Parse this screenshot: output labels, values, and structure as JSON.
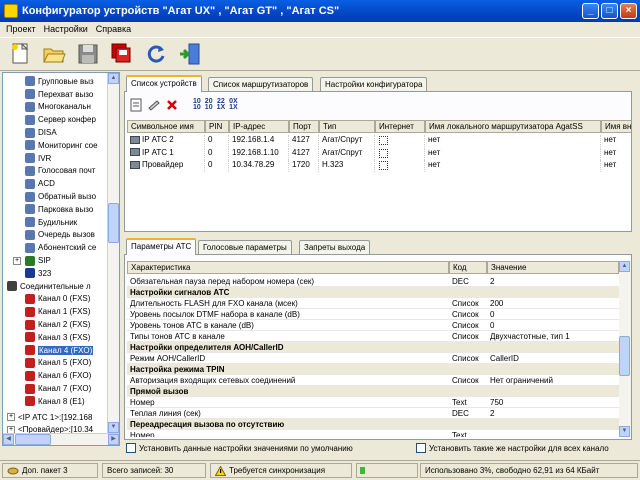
{
  "window": {
    "title": "Конфигуратор устройств \"Агат UX\" , \"Агат GT\" , \"Агат CS\""
  },
  "menu": [
    "Проект",
    "Настройки",
    "Справка"
  ],
  "tree": {
    "items": [
      {
        "label": "Групповые выз",
        "icon": "group-icon",
        "indent": 1
      },
      {
        "label": "Перехват вызо",
        "icon": "intercept-icon",
        "indent": 1
      },
      {
        "label": "Многоканальн",
        "icon": "multichannel-icon",
        "indent": 1
      },
      {
        "label": "Сервер конфер",
        "icon": "conference-icon",
        "indent": 1
      },
      {
        "label": "DISA",
        "icon": "disa-icon",
        "indent": 1
      },
      {
        "label": "Мониторинг сое",
        "icon": "monitor-icon",
        "indent": 1
      },
      {
        "label": "IVR",
        "icon": "ivr-icon",
        "indent": 1
      },
      {
        "label": "Голосовая почт",
        "icon": "voicemail-icon",
        "indent": 1
      },
      {
        "label": "ACD",
        "icon": "acd-icon",
        "indent": 1
      },
      {
        "label": "Обратный вызо",
        "icon": "callback-icon",
        "indent": 1
      },
      {
        "label": "Парковка вызо",
        "icon": "parking-icon",
        "indent": 1
      },
      {
        "label": "Будильник",
        "icon": "alarm-icon",
        "indent": 1
      },
      {
        "label": "Очередь вызов",
        "icon": "queue-icon",
        "indent": 1
      },
      {
        "label": "Абонентский се",
        "icon": "subscriber-icon",
        "indent": 1
      },
      {
        "label": "SIP",
        "icon": "sip-icon",
        "indent": 1,
        "expander": "+"
      },
      {
        "label": "323",
        "icon": "h323-icon",
        "indent": 1
      },
      {
        "label": "Соединительные л",
        "icon": "trunk-icon",
        "indent": 0,
        "expander": "-"
      },
      {
        "label": "Канал 0 (FXS)",
        "icon": "phone-icon",
        "indent": 1
      },
      {
        "label": "Канал 1 (FXS)",
        "icon": "phone-icon",
        "indent": 1
      },
      {
        "label": "Канал 2 (FXS)",
        "icon": "phone-icon",
        "indent": 1
      },
      {
        "label": "Канал 3 (FXS)",
        "icon": "phone-icon",
        "indent": 1
      },
      {
        "label": "Канал 4 (FXO)",
        "icon": "phone-icon",
        "indent": 1,
        "selected": true
      },
      {
        "label": "Канал 5 (FXO)",
        "icon": "phone-icon",
        "indent": 1
      },
      {
        "label": "Канал 6 (FXO)",
        "icon": "phone-icon",
        "indent": 1
      },
      {
        "label": "Канал 7 (FXO)",
        "icon": "phone-icon",
        "indent": 1
      },
      {
        "label": "Канал 8 (E1)",
        "icon": "phone-icon",
        "indent": 1
      }
    ],
    "bottom_items": [
      "<IP АТС 1>:[192.168",
      "<Провайдер>:[10.34"
    ]
  },
  "top_tabs": [
    "Список устройств",
    "Список маршрутизаторов",
    "Настройки конфигуратора"
  ],
  "device_toolbar": [
    "10",
    "20",
    "22",
    "0X"
  ],
  "device_table": {
    "headers": [
      "Символьное имя",
      "PIN",
      "IP-адрес",
      "Порт",
      "Тип",
      "Интернет",
      "Имя локального маршрутизатора AgatSS",
      "Имя вн"
    ],
    "rows": [
      [
        "IP АТС 2",
        "0",
        "192.168.1.4",
        "4127",
        "Агат/Спрут",
        "",
        "нет",
        "нет"
      ],
      [
        "IP АТС 1",
        "0",
        "192.168.1.10",
        "4127",
        "Агат/Спрут",
        "",
        "нет",
        "нет"
      ],
      [
        "Провайдер",
        "0",
        "10.34.78.29",
        "1720",
        "H.323",
        "",
        "нет",
        "нет"
      ]
    ]
  },
  "bottom_tabs": [
    "Параметры АТС",
    "Голосовые параметры",
    "Запреты выхода"
  ],
  "param_table": {
    "headers": [
      "Характеристика",
      "Код",
      "Значение"
    ],
    "rows": [
      {
        "name": "Обязательная пауза перед набором номера (сек)",
        "code": "DEC",
        "value": "2",
        "section": false
      },
      {
        "name": "Настройки сигналов АТС",
        "code": "",
        "value": "",
        "section": true
      },
      {
        "name": "Длительность FLASH для FXO канала (мсек)",
        "code": "Список",
        "value": "200",
        "section": false
      },
      {
        "name": "Уровень посылок DTMF набора в канале (dB)",
        "code": "Список",
        "value": "0",
        "section": false
      },
      {
        "name": "Уровень тонов АТС в канале (dB)",
        "code": "Список",
        "value": "0",
        "section": false
      },
      {
        "name": "Типы тонов АТС в канале",
        "code": "Список",
        "value": "Двухчастотные, тип 1",
        "section": false
      },
      {
        "name": "Настройки определителя АОН/CallerID",
        "code": "",
        "value": "",
        "section": true
      },
      {
        "name": "Режим АОН/CallerID",
        "code": "Список",
        "value": "CallerID",
        "section": false
      },
      {
        "name": "Настройка режима TPIN",
        "code": "",
        "value": "",
        "section": true
      },
      {
        "name": "Авторизация входящих сетевых соединений",
        "code": "Список",
        "value": "Нет ограничений",
        "section": false
      },
      {
        "name": "Прямой вызов",
        "code": "",
        "value": "",
        "section": true
      },
      {
        "name": "Номер",
        "code": "Text",
        "value": "750",
        "section": false
      },
      {
        "name": "Теплая линия (сек)",
        "code": "DEC",
        "value": "2",
        "section": false
      },
      {
        "name": "Переадресация вызова по отсутствию",
        "code": "",
        "value": "",
        "section": true
      },
      {
        "name": "Номер",
        "code": "Text",
        "value": "",
        "section": false
      }
    ]
  },
  "checkboxes": {
    "defaults_label": "Установить данные настройки значениями по умолчанию",
    "all_channels_label": "Установить такие же настройки для всех канало"
  },
  "status": {
    "package": "Доп. пакет 3",
    "records": "Всего записей: 30",
    "sync": "Требуется синхронизация",
    "usage": "Использовано 3%, свободно 62,91 из 64 КБайт",
    "usage_fraction": 0.03
  },
  "colors": {
    "title_bar": "#0346c4",
    "selection": "#316ac5",
    "section_bg": "#ece9d8"
  }
}
